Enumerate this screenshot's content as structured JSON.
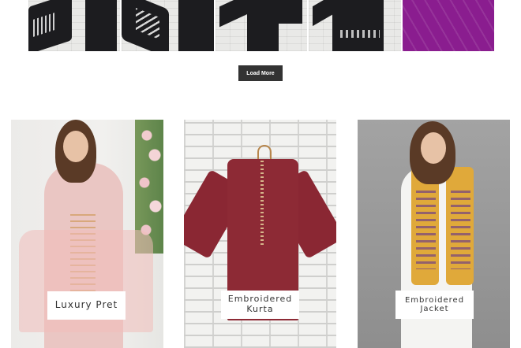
{
  "product_strip": {
    "thumbnails": [
      {
        "name": "black-printed-kurta-1"
      },
      {
        "name": "black-printed-kurta-2"
      },
      {
        "name": "black-printed-kurta-3"
      },
      {
        "name": "black-printed-kurta-4"
      },
      {
        "name": "purple-fabric"
      }
    ],
    "colors": {
      "black_garment": "#1c1c1f",
      "purple": "#8a1d8f"
    }
  },
  "load_more": {
    "label": "Load More",
    "background": "#333333",
    "text_color": "#ffffff"
  },
  "categories": [
    {
      "label": "Luxury Pret",
      "dress_color": "#eac6c3"
    },
    {
      "label": "Embroidered\nKurta",
      "dress_color": "#8d2a35"
    },
    {
      "label": "Embroidered\nJacket",
      "dress_color": "#e0a93a"
    }
  ]
}
